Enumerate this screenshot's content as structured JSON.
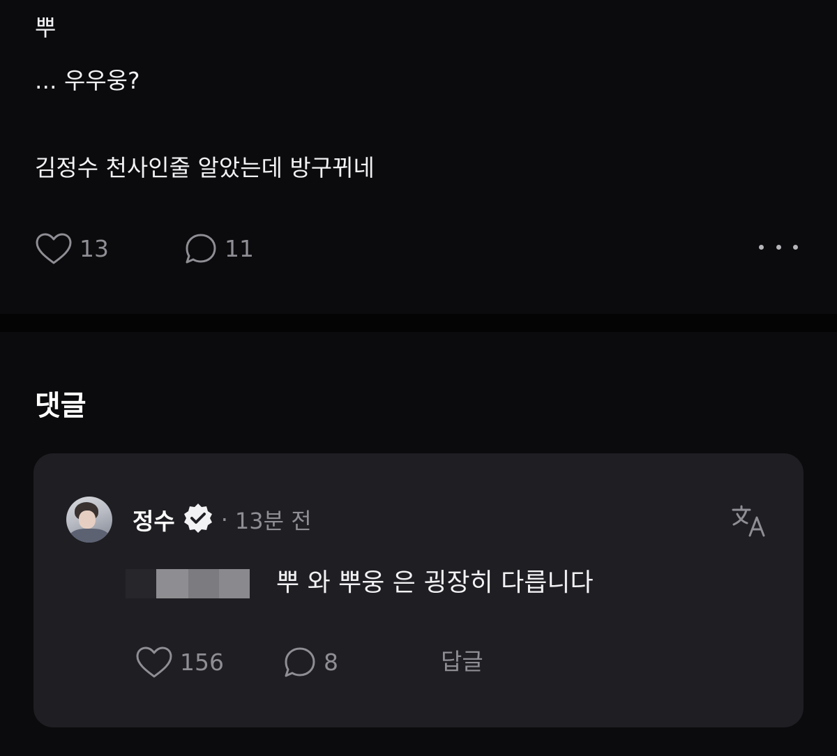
{
  "post": {
    "lines": [
      "뿌",
      "... 우우웅?",
      "김정수 천사인줄 알았는데 방구뀌네"
    ],
    "like_count": "13",
    "comment_count": "11",
    "icons": {
      "like": "heart-icon",
      "comment": "comment-bubble-icon",
      "more": "more-dots-icon"
    }
  },
  "comments_section": {
    "title": "댓글"
  },
  "comment": {
    "author": "정수",
    "separator": "·",
    "time": "13분 전",
    "text": "뿌 와 뿌웅 은 굉장히 다릅니다",
    "like_count": "156",
    "reply_count": "8",
    "reply_label": "답글",
    "icons": {
      "avatar": "avatar",
      "verified": "verified-badge-icon",
      "translate": "translate-icon",
      "like": "heart-icon",
      "comment": "comment-bubble-icon"
    }
  },
  "colors": {
    "background": "#0b0b0d",
    "card": "#1e1e23",
    "text": "#f2f2f4",
    "muted": "#8e8e94"
  }
}
